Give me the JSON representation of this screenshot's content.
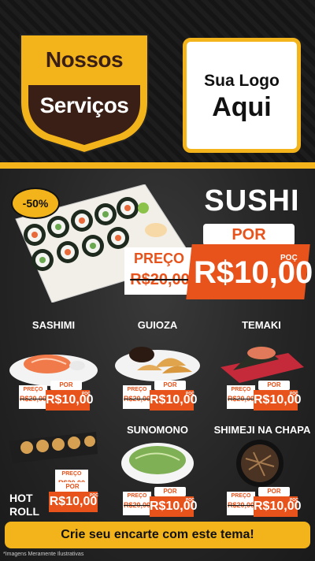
{
  "header": {
    "badge_line1": "Nossos",
    "badge_line2": "Serviços",
    "logo_line1": "Sua Logo",
    "logo_line2": "Aqui"
  },
  "hero": {
    "discount": "-50%",
    "title": "SUSHI",
    "por": "POR",
    "preco_label": "PREÇO",
    "old_price": "R$20,00",
    "new_price": "R$10,00",
    "poc": "POÇ"
  },
  "items": [
    {
      "name": "SASHIMI",
      "preco": "PREÇO",
      "old": "R$20,00",
      "por": "POR",
      "new": "R$10,00",
      "poc": "POC"
    },
    {
      "name": "GUIOZA",
      "preco": "PREÇO",
      "old": "R$20,00",
      "por": "POR",
      "new": "R$10,00",
      "poc": "POC"
    },
    {
      "name": "TEMAKI",
      "preco": "PREÇO",
      "old": "R$20,00",
      "por": "POR",
      "new": "R$10,00",
      "poc": "POC"
    },
    {
      "name": "HOT ROLL",
      "preco": "PREÇO",
      "old": "R$20,00",
      "por": "POR",
      "new": "R$10,00",
      "poc": "POC"
    },
    {
      "name": "SUNOMONO",
      "preco": "PREÇO",
      "old": "R$20,00",
      "por": "POR",
      "new": "R$10,00",
      "poc": "POC"
    },
    {
      "name": "SHIMEJI NA CHAPA",
      "preco": "PREÇO",
      "old": "R$20,00",
      "por": "POR",
      "new": "R$10,00",
      "poc": "POC"
    }
  ],
  "cta": "Crie seu encarte com este tema!",
  "footnote": "*Imagens Meramente Ilustrativas",
  "colors": {
    "accent": "#f3b31a",
    "price": "#e8521b",
    "badge_brown": "#3a1f16"
  }
}
